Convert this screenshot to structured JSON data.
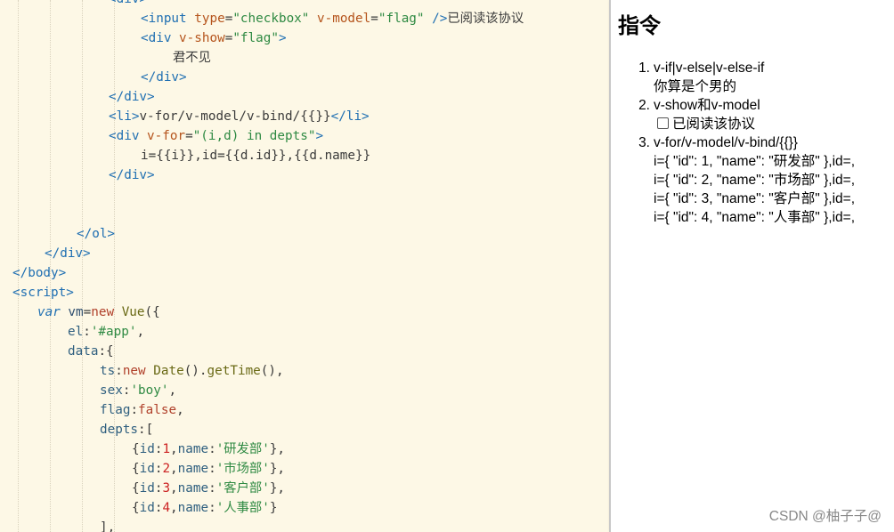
{
  "editor": {
    "lines": [
      [
        {
          "c": "tag",
          "t": "<div>"
        }
      ],
      [
        {
          "c": "tag",
          "t": "<input"
        },
        {
          "c": "plain",
          "t": " "
        },
        {
          "c": "attr",
          "t": "type"
        },
        {
          "c": "punc",
          "t": "="
        },
        {
          "c": "val",
          "t": "\"checkbox\""
        },
        {
          "c": "plain",
          "t": " "
        },
        {
          "c": "attr",
          "t": "v-model"
        },
        {
          "c": "punc",
          "t": "="
        },
        {
          "c": "val",
          "t": "\"flag\""
        },
        {
          "c": "plain",
          "t": " "
        },
        {
          "c": "tag",
          "t": "/>"
        },
        {
          "c": "text",
          "t": "已阅读该协议"
        }
      ],
      [
        {
          "c": "tag",
          "t": "<div"
        },
        {
          "c": "plain",
          "t": " "
        },
        {
          "c": "attr",
          "t": "v-show"
        },
        {
          "c": "punc",
          "t": "="
        },
        {
          "c": "val",
          "t": "\"flag\""
        },
        {
          "c": "tag",
          "t": ">"
        }
      ],
      [
        {
          "c": "text",
          "t": "君不见"
        }
      ],
      [
        {
          "c": "tag",
          "t": "</div>"
        }
      ],
      [
        {
          "c": "tag",
          "t": "</div>"
        }
      ],
      [
        {
          "c": "tag",
          "t": "<li>"
        },
        {
          "c": "text",
          "t": "v-for/v-model/v-bind/{{}}"
        },
        {
          "c": "tag",
          "t": "</li>"
        }
      ],
      [
        {
          "c": "tag",
          "t": "<div"
        },
        {
          "c": "plain",
          "t": " "
        },
        {
          "c": "attr",
          "t": "v-for"
        },
        {
          "c": "punc",
          "t": "="
        },
        {
          "c": "val",
          "t": "\"(i,d) in depts\""
        },
        {
          "c": "tag",
          "t": ">"
        }
      ],
      [
        {
          "c": "text",
          "t": "i={{i}},id={{d.id}},{{d.name}}"
        }
      ],
      [
        {
          "c": "tag",
          "t": "</div>"
        }
      ],
      [],
      [],
      [
        {
          "c": "tag",
          "t": "</ol>"
        }
      ],
      [
        {
          "c": "tag",
          "t": "</div>"
        }
      ],
      [
        {
          "c": "tag",
          "t": "</body>"
        }
      ],
      [
        {
          "c": "tag",
          "t": "<script>"
        }
      ],
      [
        {
          "c": "kwi",
          "t": "var"
        },
        {
          "c": "plain",
          "t": " vm"
        },
        {
          "c": "punc",
          "t": "="
        },
        {
          "c": "kw",
          "t": "new"
        },
        {
          "c": "plain",
          "t": " "
        },
        {
          "c": "fn",
          "t": "Vue"
        },
        {
          "c": "punc",
          "t": "({"
        }
      ],
      [
        {
          "c": "prop",
          "t": "el"
        },
        {
          "c": "punc",
          "t": ":"
        },
        {
          "c": "str",
          "t": "'#app'"
        },
        {
          "c": "punc",
          "t": ","
        }
      ],
      [
        {
          "c": "prop",
          "t": "data"
        },
        {
          "c": "punc",
          "t": ":{"
        }
      ],
      [
        {
          "c": "prop",
          "t": "ts"
        },
        {
          "c": "punc",
          "t": ":"
        },
        {
          "c": "kw",
          "t": "new"
        },
        {
          "c": "plain",
          "t": " "
        },
        {
          "c": "fn",
          "t": "Date"
        },
        {
          "c": "punc",
          "t": "()."
        },
        {
          "c": "fn",
          "t": "getTime"
        },
        {
          "c": "punc",
          "t": "(),"
        }
      ],
      [
        {
          "c": "prop",
          "t": "sex"
        },
        {
          "c": "punc",
          "t": ":"
        },
        {
          "c": "str",
          "t": "'boy'"
        },
        {
          "c": "punc",
          "t": ","
        }
      ],
      [
        {
          "c": "prop",
          "t": "flag"
        },
        {
          "c": "punc",
          "t": ":"
        },
        {
          "c": "bool",
          "t": "false"
        },
        {
          "c": "punc",
          "t": ","
        }
      ],
      [
        {
          "c": "prop",
          "t": "depts"
        },
        {
          "c": "punc",
          "t": ":["
        }
      ],
      [
        {
          "c": "punc",
          "t": "{"
        },
        {
          "c": "prop",
          "t": "id"
        },
        {
          "c": "punc",
          "t": ":"
        },
        {
          "c": "num",
          "t": "1"
        },
        {
          "c": "punc",
          "t": ","
        },
        {
          "c": "prop",
          "t": "name"
        },
        {
          "c": "punc",
          "t": ":"
        },
        {
          "c": "str",
          "t": "'研发部'"
        },
        {
          "c": "punc",
          "t": "},"
        }
      ],
      [
        {
          "c": "punc",
          "t": "{"
        },
        {
          "c": "prop",
          "t": "id"
        },
        {
          "c": "punc",
          "t": ":"
        },
        {
          "c": "num",
          "t": "2"
        },
        {
          "c": "punc",
          "t": ","
        },
        {
          "c": "prop",
          "t": "name"
        },
        {
          "c": "punc",
          "t": ":"
        },
        {
          "c": "str",
          "t": "'市场部'"
        },
        {
          "c": "punc",
          "t": "},"
        }
      ],
      [
        {
          "c": "punc",
          "t": "{"
        },
        {
          "c": "prop",
          "t": "id"
        },
        {
          "c": "punc",
          "t": ":"
        },
        {
          "c": "num",
          "t": "3"
        },
        {
          "c": "punc",
          "t": ","
        },
        {
          "c": "prop",
          "t": "name"
        },
        {
          "c": "punc",
          "t": ":"
        },
        {
          "c": "str",
          "t": "'客户部'"
        },
        {
          "c": "punc",
          "t": "},"
        }
      ],
      [
        {
          "c": "punc",
          "t": "{"
        },
        {
          "c": "prop",
          "t": "id"
        },
        {
          "c": "punc",
          "t": ":"
        },
        {
          "c": "num",
          "t": "4"
        },
        {
          "c": "punc",
          "t": ","
        },
        {
          "c": "prop",
          "t": "name"
        },
        {
          "c": "punc",
          "t": ":"
        },
        {
          "c": "str",
          "t": "'人事部'"
        },
        {
          "c": "punc",
          "t": "}"
        }
      ],
      [
        {
          "c": "punc",
          "t": "],"
        }
      ]
    ]
  },
  "preview": {
    "title": "指令",
    "items": [
      {
        "num": "1.",
        "label": "v-if|v-else|v-else-if"
      },
      {
        "num": "2.",
        "label": "v-show和v-model"
      },
      {
        "num": "3.",
        "label": "v-for/v-model/v-bind/{{}}"
      }
    ],
    "if_result": "你算是个男的",
    "checkbox_label": "已阅读该协议",
    "dept_rows": [
      "i={ \"id\": 1, \"name\": \"研发部\" },id=,",
      "i={ \"id\": 2, \"name\": \"市场部\" },id=,",
      "i={ \"id\": 3, \"name\": \"客户部\" },id=,",
      "i={ \"id\": 4, \"name\": \"人事部\" },id=,"
    ]
  },
  "watermark": "CSDN @柚子子@"
}
